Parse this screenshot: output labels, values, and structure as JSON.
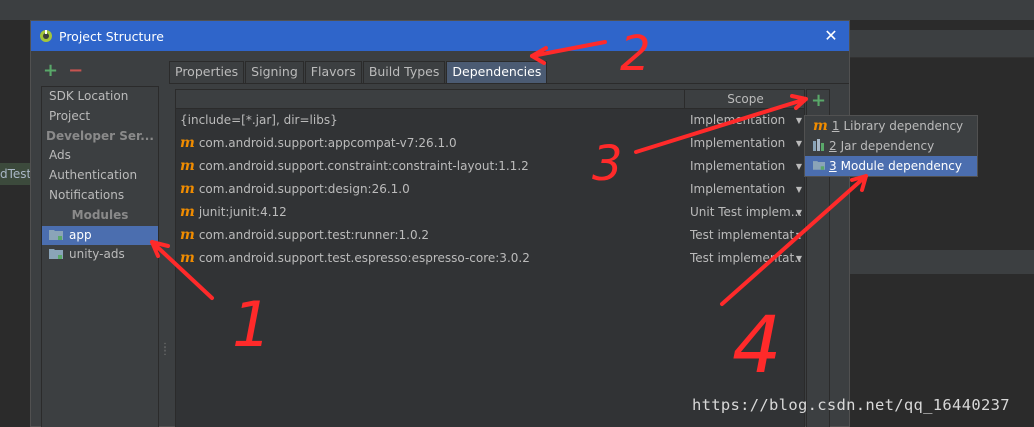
{
  "background": {
    "editor_snippet": "dTest"
  },
  "window": {
    "title": "Project Structure",
    "close_label": "✕",
    "accent": "#2f65ca"
  },
  "left_panel": {
    "add_label": "+",
    "remove_label": "−",
    "items": [
      {
        "label": "SDK Location",
        "kind": "item"
      },
      {
        "label": "Project",
        "kind": "item"
      },
      {
        "label": "Developer Ser...",
        "kind": "header"
      },
      {
        "label": "Ads",
        "kind": "item"
      },
      {
        "label": "Authentication",
        "kind": "item"
      },
      {
        "label": "Notifications",
        "kind": "item"
      },
      {
        "label": "Modules",
        "kind": "header"
      },
      {
        "label": "app",
        "kind": "module",
        "selected": true
      },
      {
        "label": "unity-ads",
        "kind": "module"
      }
    ]
  },
  "tabs": [
    {
      "label": "Properties"
    },
    {
      "label": "Signing"
    },
    {
      "label": "Flavors"
    },
    {
      "label": "Build Types"
    },
    {
      "label": "Dependencies",
      "active": true
    }
  ],
  "table": {
    "scope_header": "Scope",
    "rows": [
      {
        "name": "{include=[*.jar], dir=libs}",
        "scope": "Implementation",
        "icon": "none"
      },
      {
        "name": "com.android.support:appcompat-v7:26.1.0",
        "scope": "Implementation",
        "icon": "maven-icon"
      },
      {
        "name": "com.android.support.constraint:constraint-layout:1.1.2",
        "scope": "Implementation",
        "icon": "maven-icon"
      },
      {
        "name": "com.android.support:design:26.1.0",
        "scope": "Implementation",
        "icon": "maven-icon"
      },
      {
        "name": "junit:junit:4.12",
        "scope": "Unit Test implem...",
        "icon": "maven-icon"
      },
      {
        "name": "com.android.support.test:runner:1.0.2",
        "scope": "Test implementat...",
        "icon": "maven-icon"
      },
      {
        "name": "com.android.support.test.espresso:espresso-core:3.0.2",
        "scope": "Test implementat...",
        "icon": "maven-icon"
      }
    ]
  },
  "right_toolbar": {
    "add_label": "+"
  },
  "popup": {
    "items": [
      {
        "num": "1",
        "label": "Library dependency",
        "icon": "maven-icon"
      },
      {
        "num": "2",
        "label": "Jar dependency",
        "icon": "jar-icon"
      },
      {
        "num": "3",
        "label": "Module dependency",
        "icon": "module-folder-icon",
        "selected": true
      }
    ]
  },
  "annotations": {
    "numbers": [
      "1",
      "2",
      "3",
      "4"
    ],
    "color": "#ff2a2a"
  },
  "watermark": "https://blog.csdn.net/qq_16440237"
}
